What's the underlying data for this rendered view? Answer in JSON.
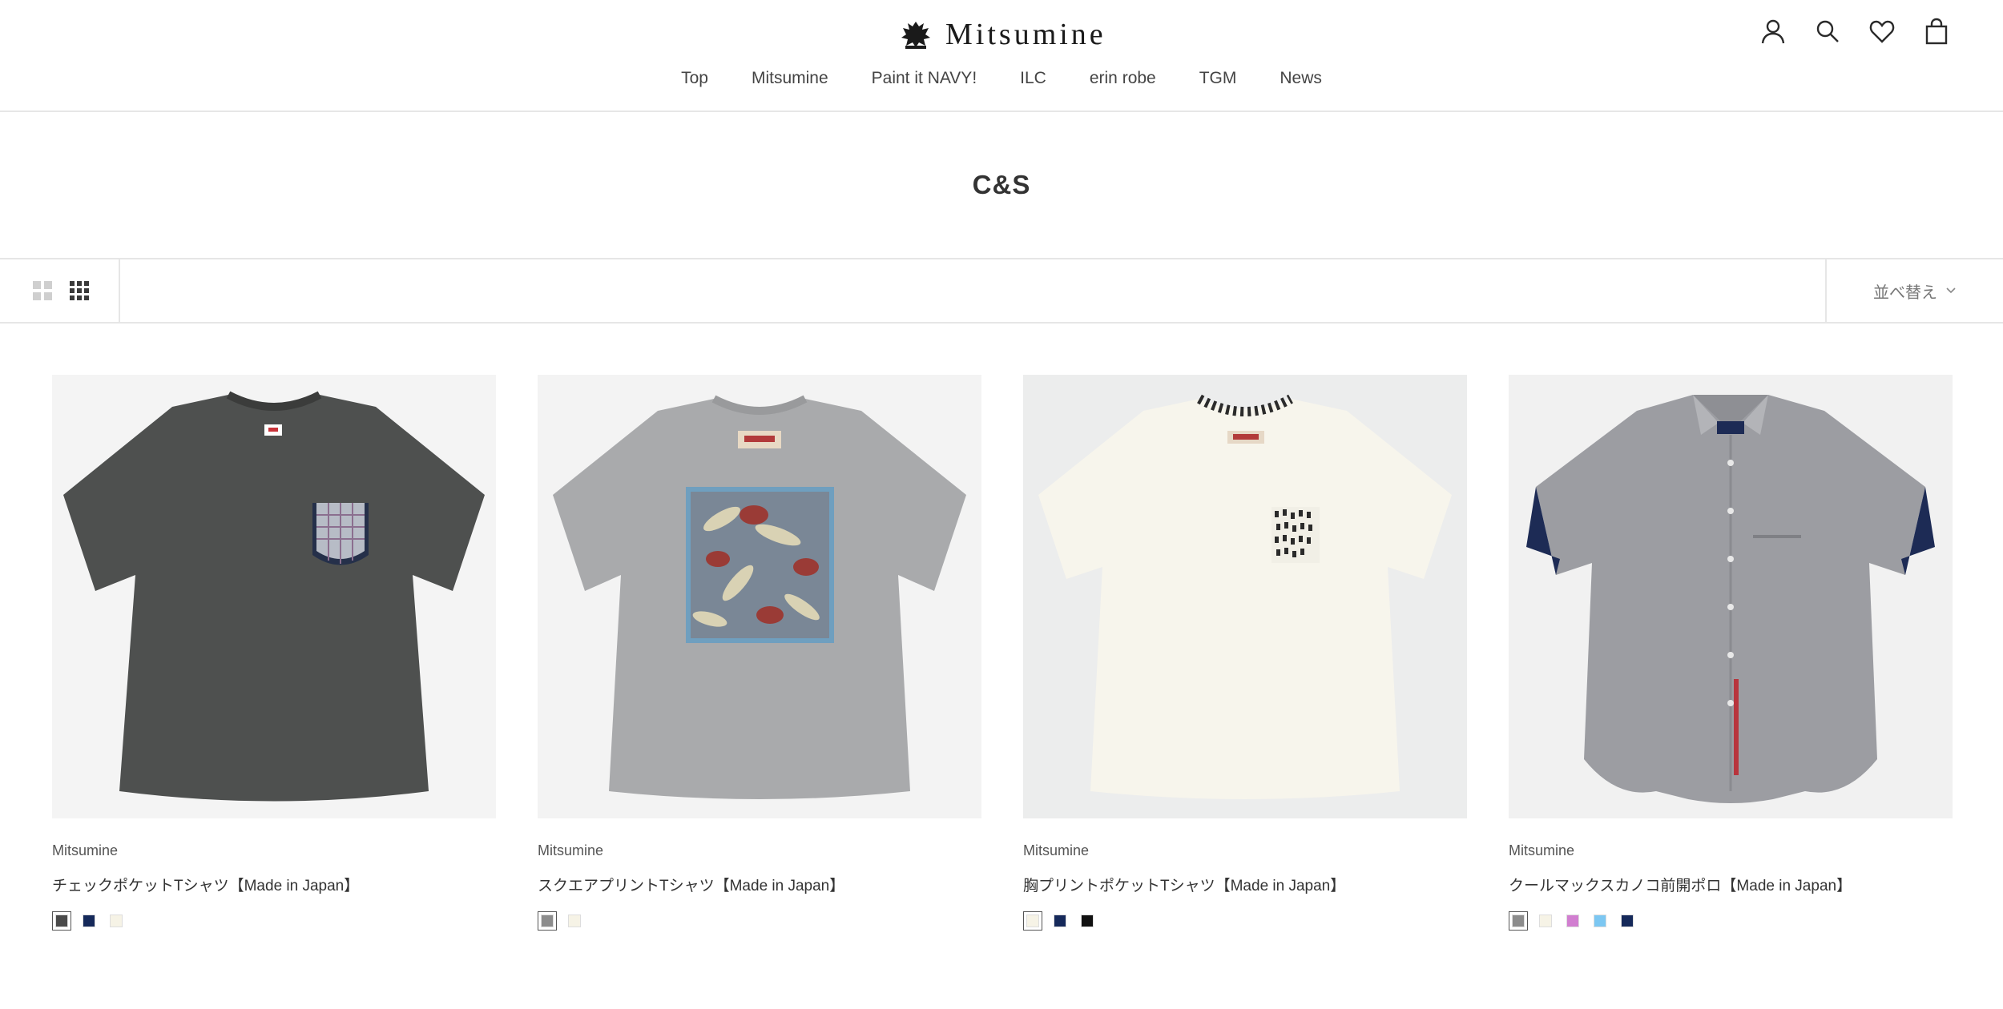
{
  "brand": {
    "name": "Mitsumine"
  },
  "nav": [
    "Top",
    "Mitsumine",
    "Paint it NAVY!",
    "ILC",
    "erin robe",
    "TGM",
    "News"
  ],
  "icons": [
    "account-icon",
    "search-icon",
    "wishlist-heart-icon",
    "cart-bag-icon"
  ],
  "collection": {
    "title": "C&S"
  },
  "toolbar": {
    "sort_label": "並べ替え"
  },
  "products": [
    {
      "vendor": "Mitsumine",
      "name": "チェックポケットTシャツ【Made in Japan】",
      "image": "dark grey t-shirt with check pocket",
      "swatches": [
        {
          "color": "#4a4a4a",
          "selected": true
        },
        {
          "color": "#15295a",
          "selected": false
        },
        {
          "color": "#f6f3e6",
          "selected": false
        }
      ]
    },
    {
      "vendor": "Mitsumine",
      "name": "スクエアプリントTシャツ【Made in Japan】",
      "image": "grey t-shirt with square botanical print",
      "swatches": [
        {
          "color": "#8c8c8c",
          "selected": true
        },
        {
          "color": "#f6f3e6",
          "selected": false
        }
      ]
    },
    {
      "vendor": "Mitsumine",
      "name": "胸プリントポケットTシャツ【Made in Japan】",
      "image": "off-white t-shirt with printed chest pocket",
      "swatches": [
        {
          "color": "#f6f3e6",
          "selected": true
        },
        {
          "color": "#15295a",
          "selected": false
        },
        {
          "color": "#111111",
          "selected": false
        }
      ]
    },
    {
      "vendor": "Mitsumine",
      "name": "クールマックスカノコ前開ポロ【Made in Japan】",
      "image": "grey short sleeve button-down polo shirt",
      "swatches": [
        {
          "color": "#8c8c8c",
          "selected": true
        },
        {
          "color": "#f6f3e6",
          "selected": false
        },
        {
          "color": "#d17ed0",
          "selected": false
        },
        {
          "color": "#7cc7f2",
          "selected": false
        },
        {
          "color": "#15295a",
          "selected": false
        }
      ]
    }
  ]
}
